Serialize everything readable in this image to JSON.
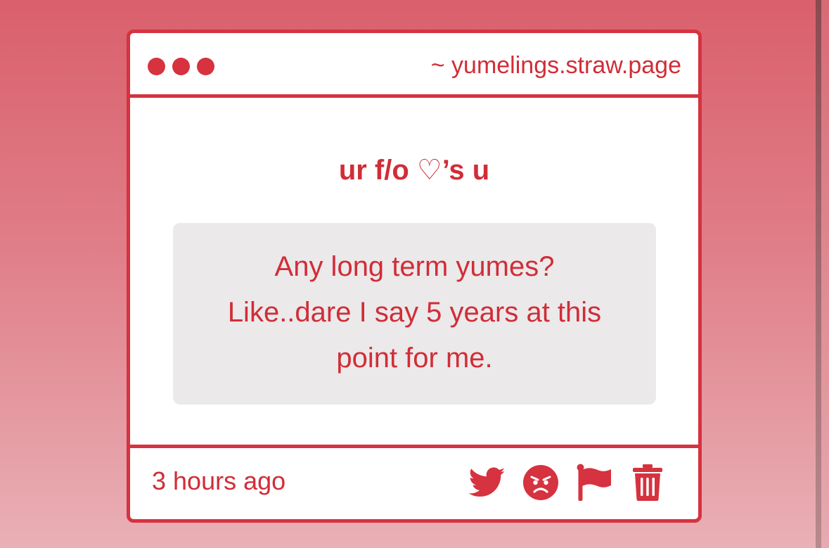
{
  "window": {
    "url": "~ yumelings.straw.page"
  },
  "content": {
    "heading": "ur f/o ♡’s u",
    "message_line1": "Any long term yumes?",
    "message_line2": "Like..dare I say 5 years at this",
    "message_line3": "point for me."
  },
  "footer": {
    "timestamp": "3 hours ago",
    "icons": [
      "twitter-icon",
      "angry-face-icon",
      "flag-icon",
      "trash-icon"
    ]
  },
  "colors": {
    "accent": "#d6323f",
    "text": "#d12d37",
    "message_bg": "#ebe9ea",
    "window_bg": "#ffffff"
  }
}
